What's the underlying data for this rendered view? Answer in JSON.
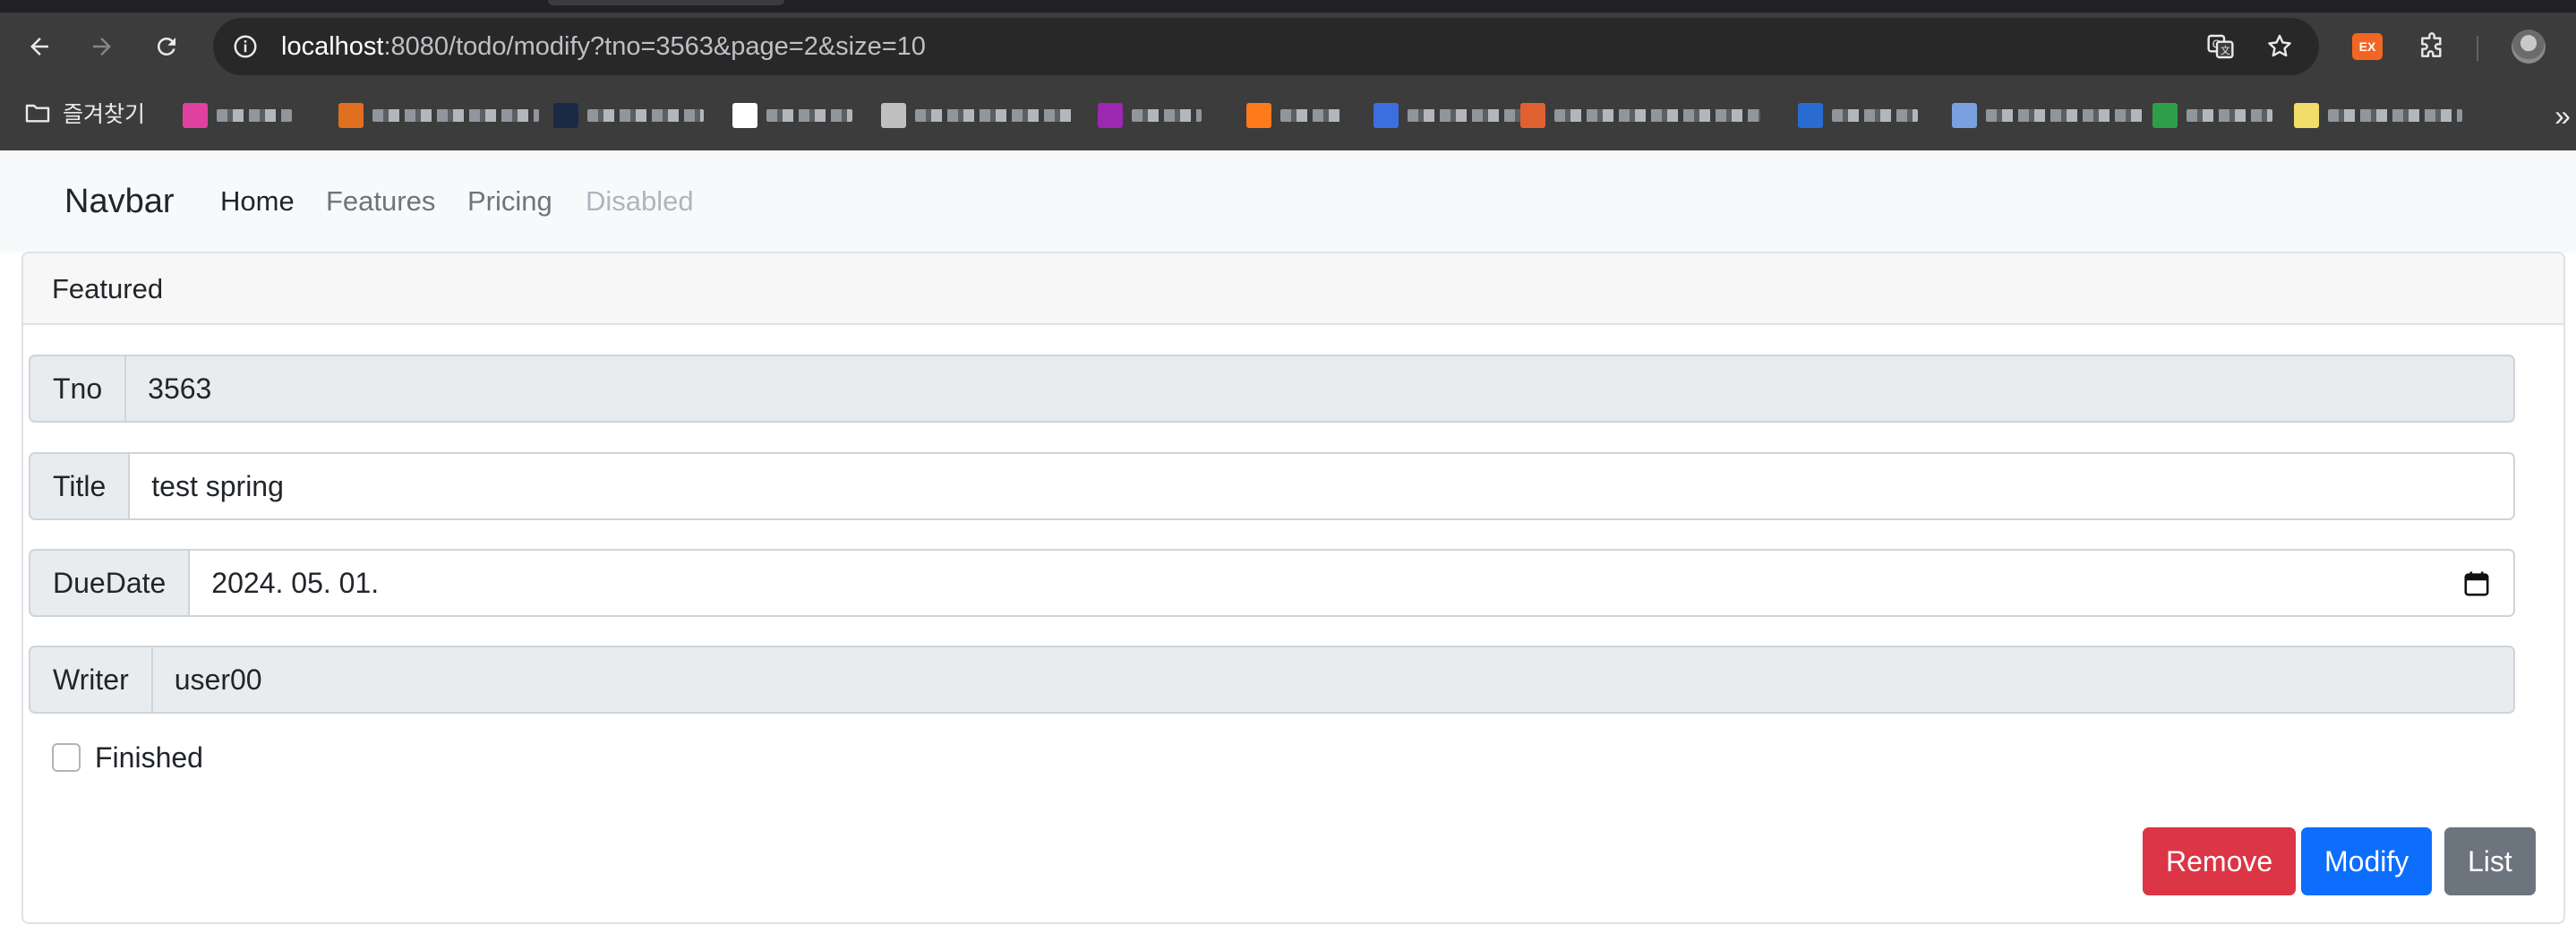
{
  "browser": {
    "url_host": "localhost",
    "url_rest": ":8080/todo/modify?tno=3563&page=2&size=10",
    "extension_badge": "EX",
    "bookmarks_folder_label": "즐겨찾기",
    "bookmarks": [
      {
        "color": "#e040a0"
      },
      {
        "color": "#e07020"
      },
      {
        "color": "#1a2a44"
      },
      {
        "color": "#ffffff"
      },
      {
        "color": "#c0c0c0"
      },
      {
        "color": "#9c27b0"
      },
      {
        "color": "#ff7a1a"
      },
      {
        "color": "#3b6fe0"
      },
      {
        "color": "#e06030"
      },
      {
        "color": "#2a6bd1"
      },
      {
        "color": "#7aa0e0"
      },
      {
        "color": "#2e9e4a"
      },
      {
        "color": "#f2dc6a"
      }
    ]
  },
  "navbar": {
    "brand": "Navbar",
    "links": [
      {
        "label": "Home",
        "state": "active"
      },
      {
        "label": "Features",
        "state": "normal"
      },
      {
        "label": "Pricing",
        "state": "normal"
      },
      {
        "label": "Disabled",
        "state": "disabled"
      }
    ]
  },
  "card": {
    "header": "Featured",
    "fields": {
      "tno": {
        "label": "Tno",
        "value": "3563"
      },
      "title": {
        "label": "Title",
        "value": "test spring"
      },
      "duedate": {
        "label": "DueDate",
        "value": "2024. 05. 01."
      },
      "writer": {
        "label": "Writer",
        "value": "user00"
      }
    },
    "finished": {
      "label": "Finished",
      "checked": false
    },
    "buttons": {
      "remove": {
        "label": "Remove",
        "color": "#dc3545"
      },
      "modify": {
        "label": "Modify",
        "color": "#0d6efd"
      },
      "list": {
        "label": "List",
        "color": "#6c757d"
      }
    }
  }
}
